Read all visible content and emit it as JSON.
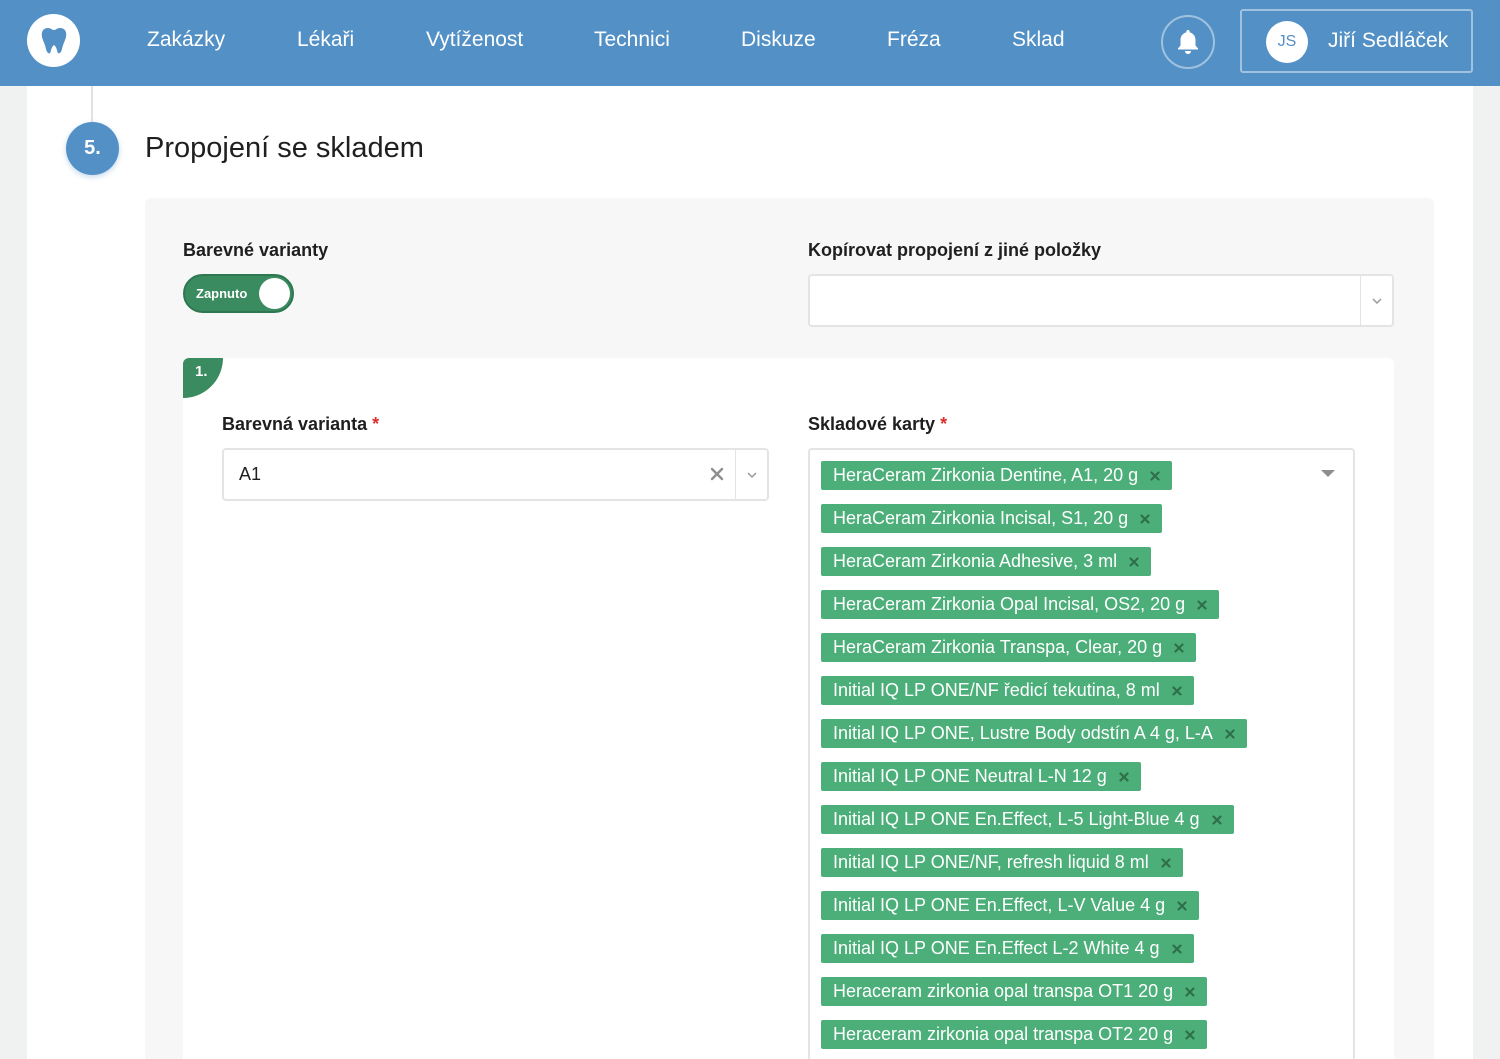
{
  "colors": {
    "nav_bg": "#5290c5",
    "accent_green": "#3a8b5f",
    "tag_green": "#4caf7a",
    "required_red": "#d9302c"
  },
  "nav": {
    "logo_icon": "tooth-icon",
    "items": [
      {
        "label": "Zakázky"
      },
      {
        "label": "Lékaři"
      },
      {
        "label": "Vytíženost"
      },
      {
        "label": "Technici"
      },
      {
        "label": "Diskuze"
      },
      {
        "label": "Fréza"
      },
      {
        "label": "Sklad"
      }
    ],
    "notification_icon": "bell-icon",
    "user": {
      "initials": "JS",
      "name": "Jiří Sedláček"
    }
  },
  "section": {
    "step_number": "5.",
    "title": "Propojení se skladem",
    "color_variants": {
      "label": "Barevné varianty",
      "toggle_label": "Zapnuto",
      "enabled": true
    },
    "copy_connection": {
      "label": "Kopírovat propojení z jiné položky",
      "value": ""
    },
    "variant": {
      "index": "1.",
      "color_variant_label": "Barevná varianta",
      "required_mark": "*",
      "color_variant_value": "A1",
      "stock_cards_label": "Skladové karty",
      "stock_cards": [
        "HeraCeram Zirkonia Dentine, A1, 20 g",
        "HeraCeram Zirkonia Incisal, S1, 20 g",
        "HeraCeram Zirkonia Adhesive, 3 ml",
        "HeraCeram Zirkonia Opal Incisal, OS2, 20 g",
        "HeraCeram Zirkonia Transpa, Clear, 20 g",
        "Initial IQ LP ONE/NF ředicí tekutina, 8 ml",
        "Initial IQ LP ONE, Lustre Body odstín A 4 g, L-A",
        "Initial IQ LP ONE Neutral L-N 12 g",
        "Initial IQ LP ONE En.Effect, L-5 Light-Blue 4 g",
        "Initial IQ LP ONE/NF, refresh liquid 8 ml",
        "Initial IQ LP ONE En.Effect, L-V Value 4 g",
        "Initial IQ LP ONE En.Effect L-2 White 4 g",
        "Heraceram zirkonia opal transpa OT1 20 g",
        "Heraceram zirkonia opal transpa OT2 20 g"
      ]
    }
  }
}
